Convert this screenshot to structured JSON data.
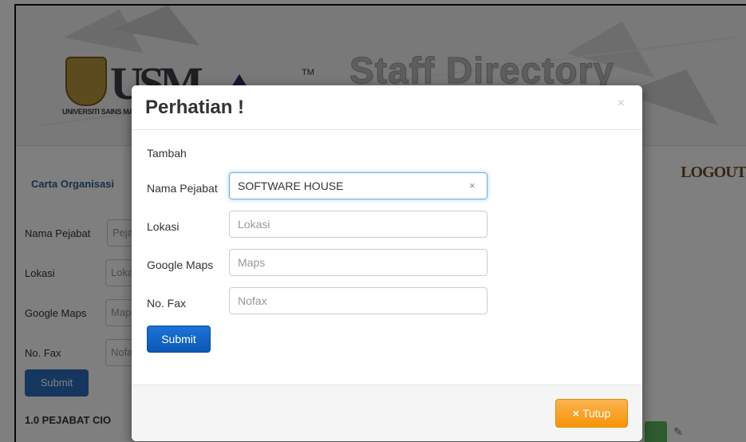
{
  "background": {
    "banner_title": "Staff Directory System",
    "logo_text": "USM",
    "logo_university": "UNIVERSITI SAINS MALAYSIA",
    "logo_apex": "APEX",
    "logo_tm": "TM",
    "nav_link": "Carta Organisasi",
    "logout_label": "LOGOUT",
    "form": {
      "nama_pejabat_label": "Nama Pejabat",
      "nama_pejabat_placeholder": "Pejabat",
      "lokasi_label": "Lokasi",
      "lokasi_placeholder": "Lokasi",
      "google_maps_label": "Google Maps",
      "google_maps_placeholder": "Maps",
      "no_fax_label": "No. Fax",
      "no_fax_placeholder": "Nofax",
      "submit_label": "Submit"
    },
    "section_heading": "1.0 PEJABAT CIO"
  },
  "modal": {
    "title": "Perhatian !",
    "close_symbol": "×",
    "section_title": "Tambah",
    "fields": {
      "nama_pejabat": {
        "label": "Nama Pejabat",
        "value": "SOFTWARE HOUSE",
        "placeholder": ""
      },
      "lokasi": {
        "label": "Lokasi",
        "value": "",
        "placeholder": "Lokasi"
      },
      "google_maps": {
        "label": "Google Maps",
        "value": "",
        "placeholder": "Maps"
      },
      "no_fax": {
        "label": "No. Fax",
        "value": "",
        "placeholder": "Nofax"
      }
    },
    "clear_symbol": "×",
    "submit_label": "Submit",
    "close_button": {
      "icon": "×",
      "label": "Tutup"
    }
  },
  "colors": {
    "primary_button": "#0b58b6",
    "warning_button": "#f89406",
    "backdrop": "rgba(0,0,0,0.5)",
    "link": "#2a6496"
  }
}
